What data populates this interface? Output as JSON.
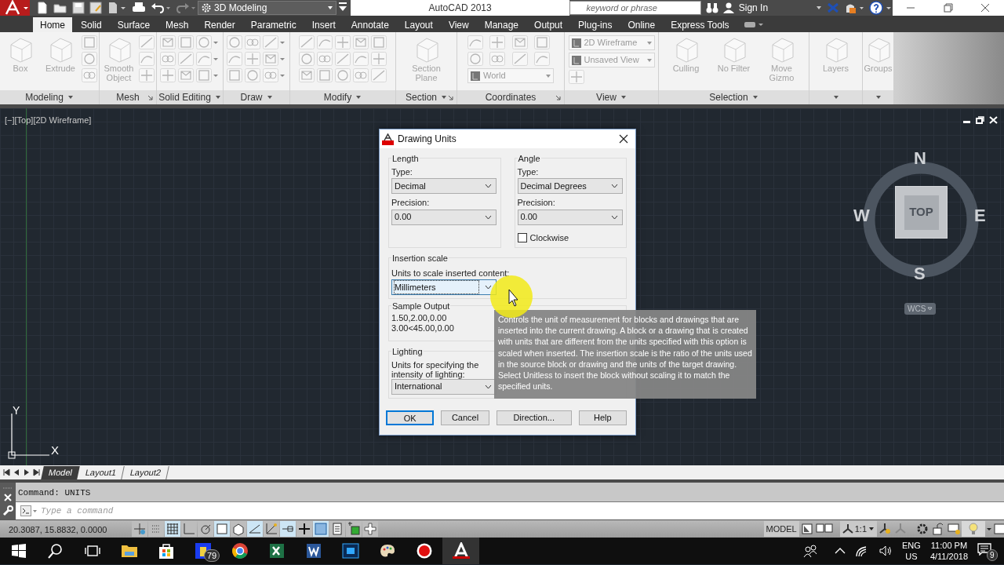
{
  "title_bar": {
    "workspace": "3D Modeling",
    "title": "AutoCAD 2013",
    "search": {
      "placeholder": "keyword or phrase"
    },
    "sign_in": "Sign In"
  },
  "ribbon_tabs": [
    {
      "label": "Home",
      "selected": true
    },
    {
      "label": "Solid",
      "selected": false
    },
    {
      "label": "Surface",
      "selected": false
    },
    {
      "label": "Mesh",
      "selected": false
    },
    {
      "label": "Render",
      "selected": false
    },
    {
      "label": "Parametric",
      "selected": false
    },
    {
      "label": "Insert",
      "selected": false
    },
    {
      "label": "Annotate",
      "selected": false
    },
    {
      "label": "Layout",
      "selected": false
    },
    {
      "label": "View",
      "selected": false
    },
    {
      "label": "Manage",
      "selected": false
    },
    {
      "label": "Output",
      "selected": false
    },
    {
      "label": "Plug-ins",
      "selected": false
    },
    {
      "label": "Online",
      "selected": false
    },
    {
      "label": "Express Tools",
      "selected": false
    }
  ],
  "ribbon_panels": [
    {
      "title": "Modeling",
      "tools": [
        "Box",
        "Extrude"
      ]
    },
    {
      "title": "Mesh",
      "tools": [
        "Smooth Object"
      ]
    },
    {
      "title": "Solid Editing"
    },
    {
      "title": "Draw"
    },
    {
      "title": "Modify"
    },
    {
      "title": "Section",
      "tools": [
        "Section Plane"
      ]
    },
    {
      "title": "Coordinates",
      "dropdowns": [
        "World"
      ]
    },
    {
      "title": "View",
      "dropdowns": [
        "2D Wireframe",
        "Unsaved View"
      ]
    },
    {
      "title": "Selection",
      "tools": [
        "Culling",
        "No Filter",
        "Move Gizmo"
      ]
    },
    {
      "tools": [
        "Layers"
      ]
    },
    {
      "tools": [
        "Groups"
      ]
    }
  ],
  "viewport": {
    "label": "[−][Top][2D Wireframe]",
    "compass": {
      "north": "N",
      "south": "S",
      "east": "E",
      "west": "W",
      "face": "TOP",
      "ucs": "WCS"
    },
    "ucs_icon": {
      "x": "X",
      "y": "Y"
    }
  },
  "dialog": {
    "title": "Drawing Units",
    "length": {
      "heading": "Length",
      "type_label": "Type:",
      "type": "Decimal",
      "precision_label": "Precision:",
      "precision": "0.00"
    },
    "angle": {
      "heading": "Angle",
      "type_label": "Type:",
      "type": "Decimal Degrees",
      "precision_label": "Precision:",
      "precision": "0.00",
      "clockwise": {
        "label": "Clockwise",
        "checked": false
      }
    },
    "insertion": {
      "heading": "Insertion scale",
      "label": "Units to scale inserted content:",
      "value": "Millimeters"
    },
    "sample": {
      "heading": "Sample Output",
      "lines": [
        "1.50,2.00,0.00",
        "3.00<45.00,0.00"
      ]
    },
    "lighting": {
      "heading": "Lighting",
      "label": "Units for specifying the intensity of lighting:",
      "value": "International"
    },
    "buttons": [
      {
        "label": "OK",
        "default": true
      },
      {
        "label": "Cancel",
        "default": false
      },
      {
        "label": "Direction...",
        "default": false
      },
      {
        "label": "Help",
        "default": false
      }
    ]
  },
  "tooltip": "Controls the unit of measurement for blocks and drawings that are inserted into the current drawing. A block or a drawing that is created with units that are different from the units specified with this option is scaled when inserted. The insertion scale is the ratio of the units used in the source block or drawing and the units of the target drawing. Select Unitless to insert the block without scaling it to match the specified units.",
  "layout_tabs": [
    {
      "label": "Model",
      "selected": true
    },
    {
      "label": "Layout1",
      "selected": false
    },
    {
      "label": "Layout2",
      "selected": false
    }
  ],
  "command_line": {
    "history": "Command: UNITS",
    "placeholder": "Type a command"
  },
  "status_bar": {
    "coordinates": "20.3087, 15.8832, 0.0000",
    "toggles": [
      {
        "on": false
      },
      {
        "on": false
      },
      {
        "on": true
      },
      {
        "on": false
      },
      {
        "on": false
      },
      {
        "on": true
      },
      {
        "on": false
      },
      {
        "on": true
      },
      {
        "on": false
      },
      {
        "on": true
      },
      {
        "on": false
      },
      {
        "on": true
      },
      {
        "on": false
      },
      {
        "on": false
      },
      {
        "on": false
      }
    ],
    "space": "MODEL",
    "scale": "1:1"
  },
  "taskbar": {
    "badge": "79",
    "language": "ENG",
    "region": "US",
    "time": "11:00 PM",
    "date": "4/11/2018",
    "notifications": "9"
  }
}
